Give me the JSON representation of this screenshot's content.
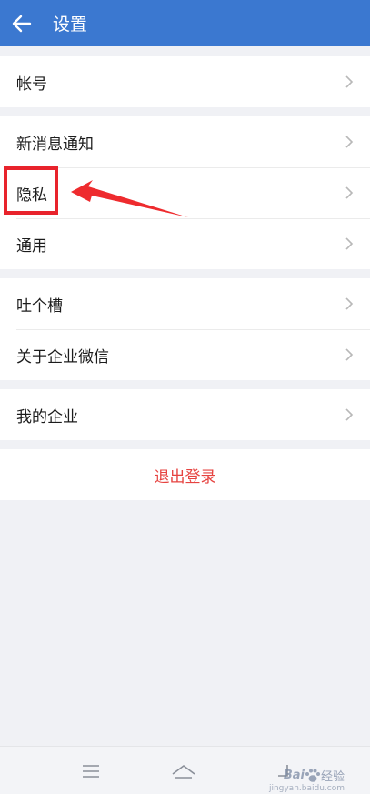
{
  "header": {
    "title": "设置",
    "back_icon": "arrow-left-icon",
    "background": "#3b78d0"
  },
  "groups": [
    {
      "items": [
        {
          "label": "帐号"
        }
      ]
    },
    {
      "items": [
        {
          "label": "新消息通知"
        },
        {
          "label": "隐私"
        },
        {
          "label": "通用"
        }
      ]
    },
    {
      "items": [
        {
          "label": "吐个槽"
        },
        {
          "label": "关于企业微信"
        }
      ]
    },
    {
      "items": [
        {
          "label": "我的企业"
        }
      ]
    }
  ],
  "logout": {
    "label": "退出登录",
    "color": "#e64340"
  },
  "annotation": {
    "target": "隐私",
    "color": "#e8232c"
  },
  "navbar": {
    "buttons": [
      "menu-icon",
      "home-icon",
      "back-icon"
    ]
  },
  "watermark": {
    "brand": "Bai",
    "brand_suffix": "经验",
    "url": "jingyan.baidu.com"
  }
}
